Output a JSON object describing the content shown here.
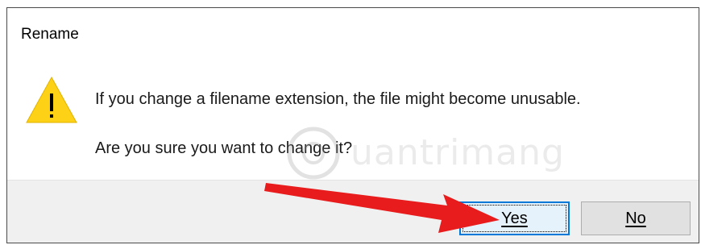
{
  "dialog": {
    "title": "Rename",
    "icon": "warning-icon",
    "message": "If you change a filename extension, the file might become unusable.",
    "question": "Are you sure you want to change it?",
    "buttons": {
      "yes_label": "Yes",
      "no_label": "No"
    }
  },
  "watermark": {
    "text": "uantrimang"
  },
  "annotation": {
    "arrow_color": "#e81c1c"
  },
  "colors": {
    "accent": "#0078d7",
    "warning": "#fcd116",
    "footer_bg": "#f0f0f0"
  }
}
